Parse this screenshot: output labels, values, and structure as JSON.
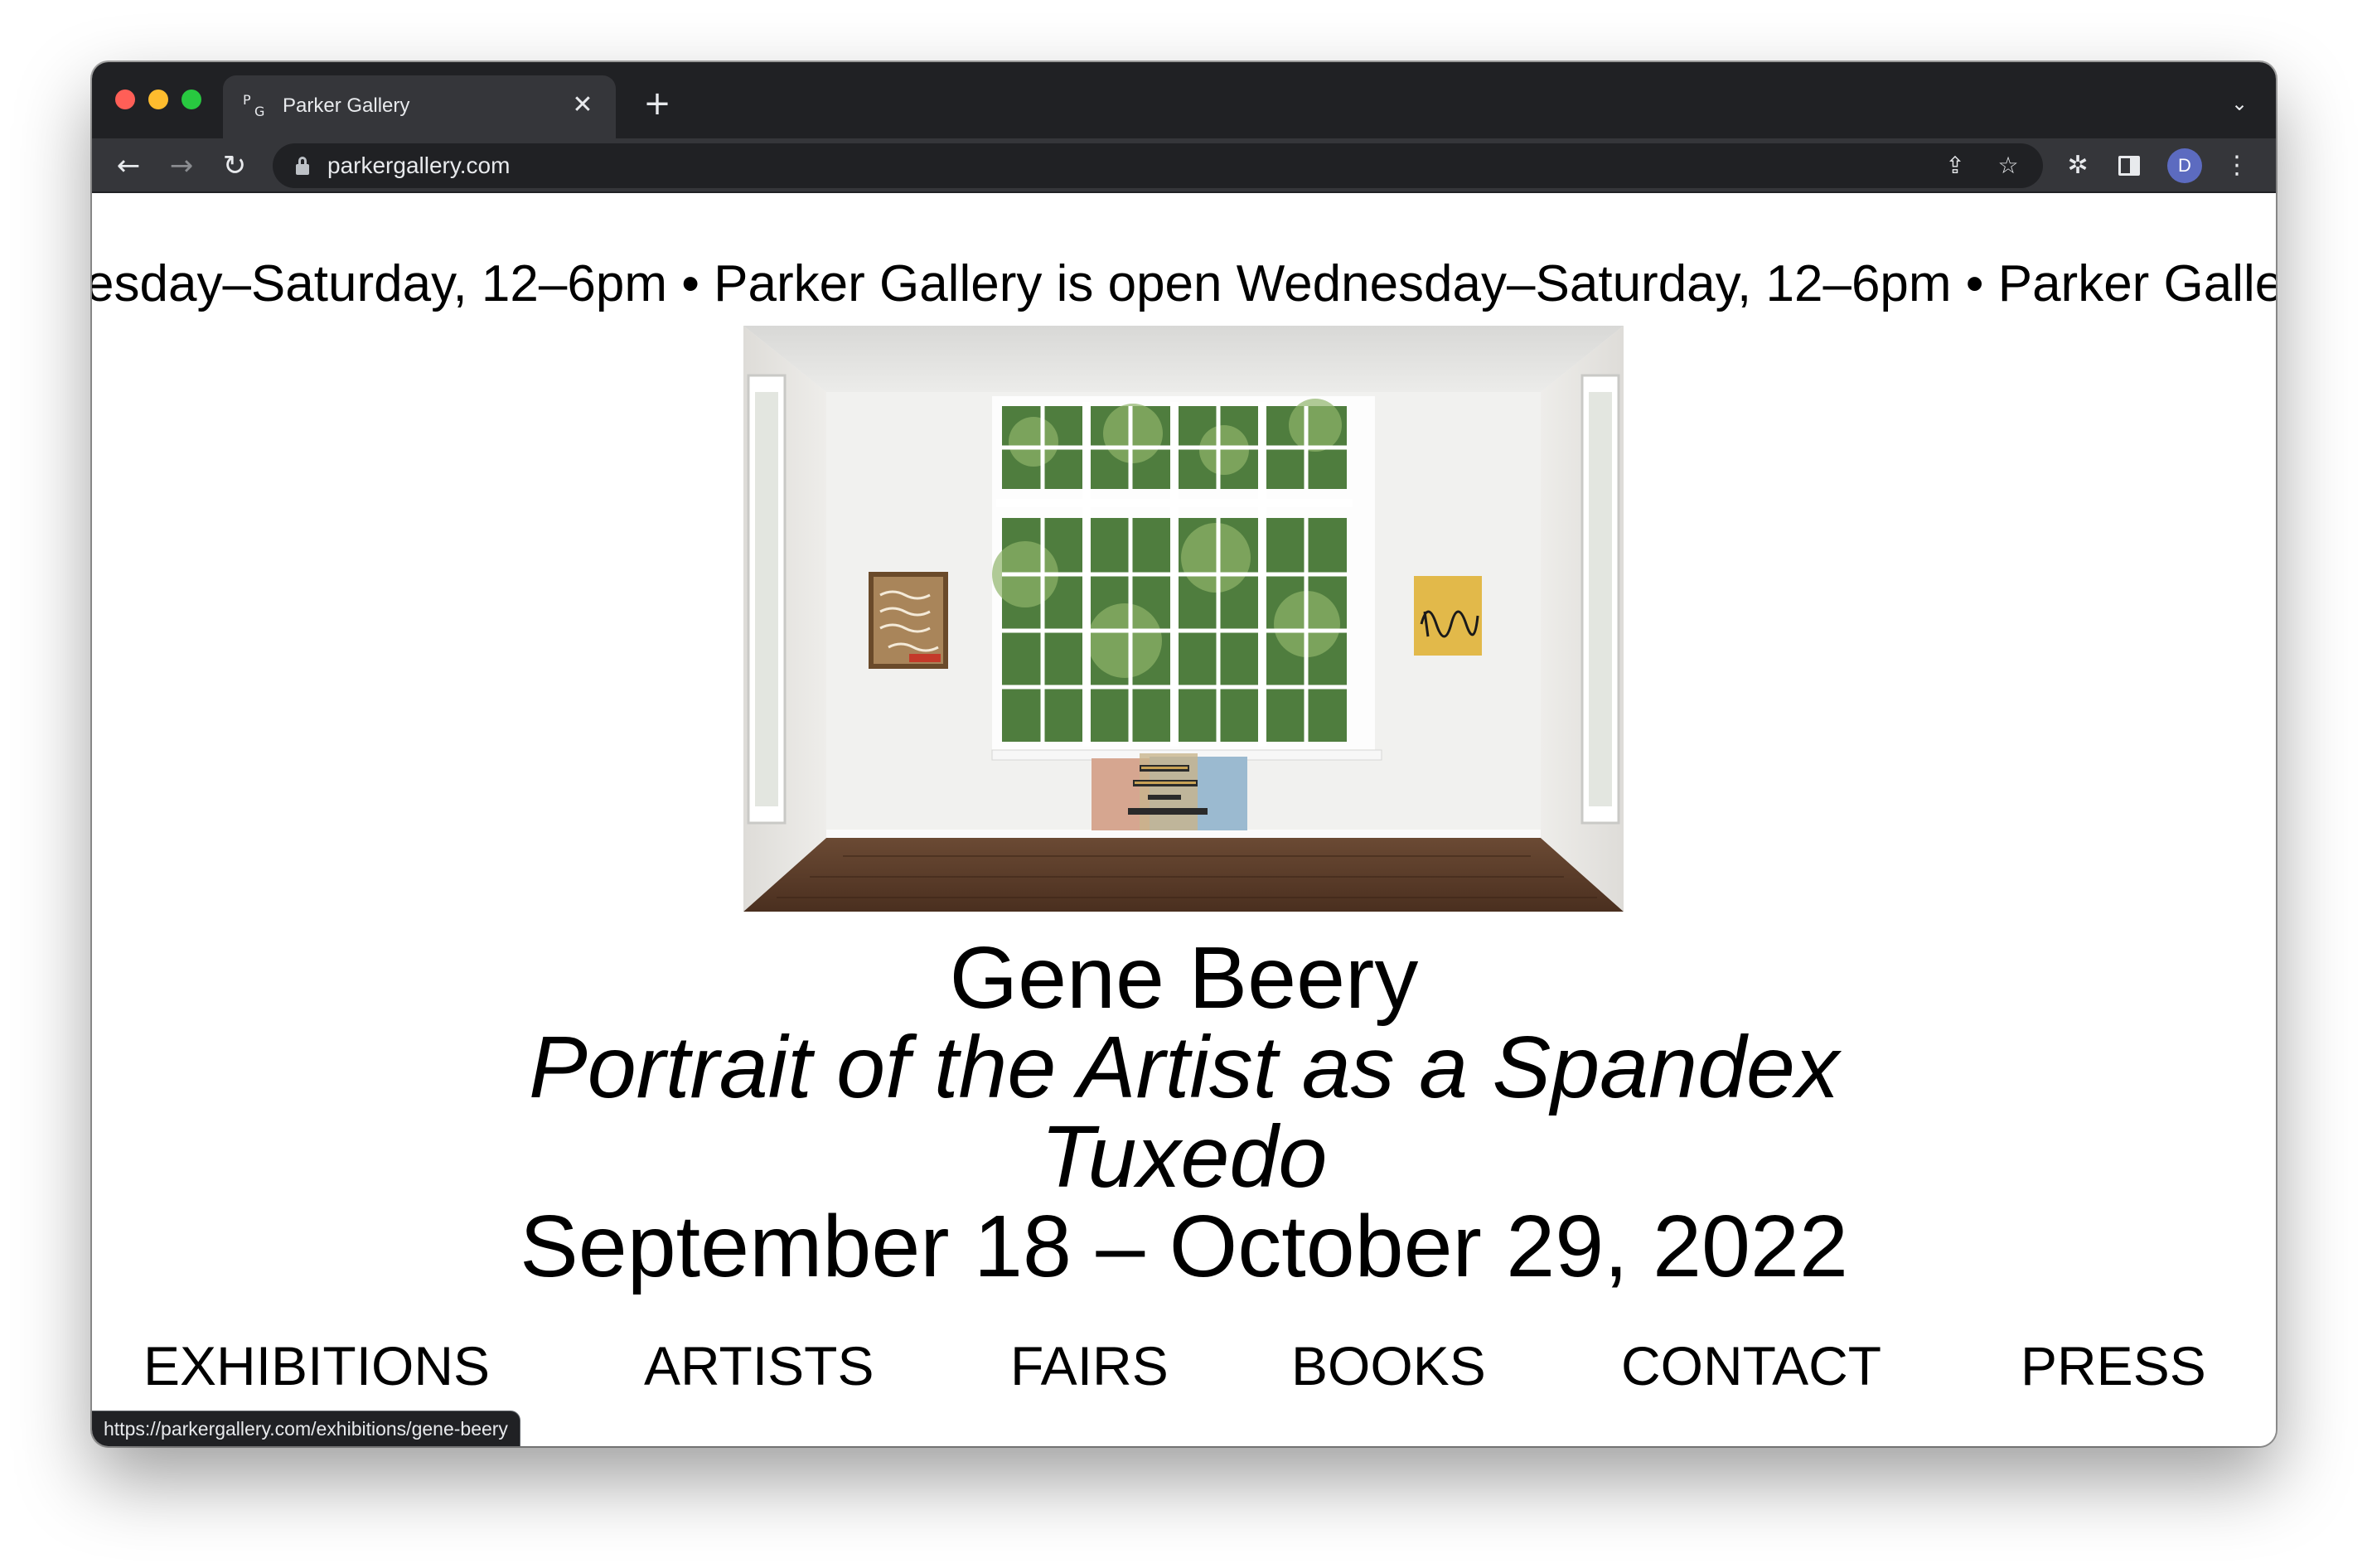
{
  "browser": {
    "tab": {
      "favicon_p": "P",
      "favicon_g": "G",
      "title": "Parker Gallery",
      "close_glyph": "✕"
    },
    "new_tab_glyph": "+",
    "tab_list_glyph": "⌄",
    "nav": {
      "back_glyph": "←",
      "forward_glyph": "→",
      "reload_glyph": "↻"
    },
    "omnibox": {
      "url": "parkergallery.com",
      "share_glyph": "⇪",
      "star_glyph": "☆"
    },
    "extensions_glyph": "✲",
    "avatar_initial": "D",
    "menu_glyph": "⋮",
    "status_url": "https://parkergallery.com/exhibitions/gene-beery"
  },
  "page": {
    "marquee": "esday–Saturday, 12–6pm  •  Parker Gallery is open Wednesday–Saturday, 12–6pm  •  Parker Gallery is open Wedn",
    "exhibition": {
      "artist": "Gene Beery",
      "title_line1": "Portrait of the Artist as a Spandex",
      "title_line2": "Tuxedo",
      "dates": "September 18 – October 29, 2022"
    },
    "nav": [
      {
        "label": "EXHIBITIONS"
      },
      {
        "label": "ARTISTS"
      },
      {
        "label": "FAIRS"
      },
      {
        "label": "BOOKS"
      },
      {
        "label": "CONTACT"
      },
      {
        "label": "PRESS"
      }
    ]
  }
}
